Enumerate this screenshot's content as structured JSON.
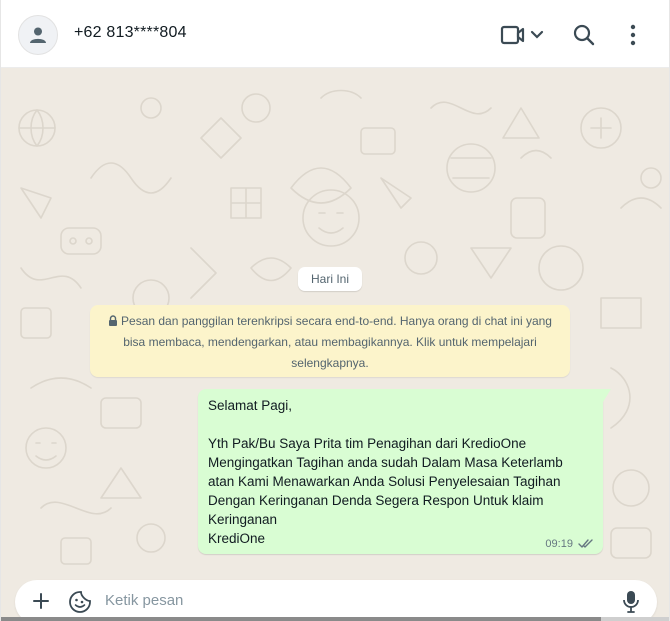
{
  "header": {
    "contact_name": "+62 813****804"
  },
  "chat": {
    "date_chip": "Hari Ini",
    "encryption_notice": "Pesan dan panggilan terenkripsi secara end-to-end. Hanya orang di chat ini yang bisa membaca, mendengarkan, atau membagikannya. Klik untuk mempelajari selengkapnya.",
    "messages": [
      {
        "direction": "outgoing",
        "text": "Selamat Pagi,\n\nYth Pak/Bu Saya Prita tim Penagihan dari KredioOne\nMengingatkan Tagihan anda sudah Dalam Masa Keterlamb\natan Kami Menawarkan Anda Solusi Penyelesaian Tagihan\nDengan Keringanan Denda Segera Respon Untuk klaim\nKeringanan\nKrediOne",
        "time": "09:19",
        "status": "read"
      }
    ]
  },
  "composer": {
    "placeholder": "Ketik pesan"
  },
  "icons": {
    "avatar": "person-icon",
    "video": "video-camera-icon",
    "dropdown": "chevron-down-icon",
    "search": "search-icon",
    "menu": "more-vertical-icon",
    "lock": "lock-icon",
    "attach": "plus-icon",
    "sticker": "sticker-icon",
    "mic": "microphone-icon",
    "read_receipt": "double-check-icon"
  },
  "colors": {
    "chat_background": "#efeae2",
    "outgoing_bubble": "#d9fdd3",
    "encryption_notice_bg": "#fcf4cb",
    "header_bg": "#ffffff"
  }
}
